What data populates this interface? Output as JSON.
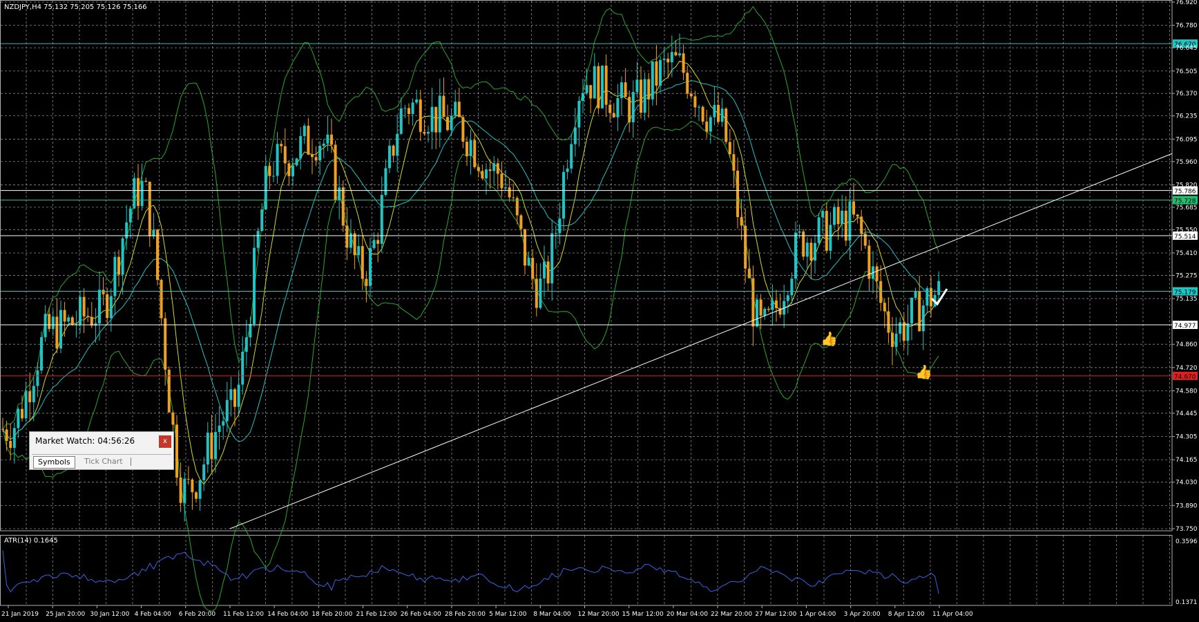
{
  "symbol_info": "NZDJPY,H4  75.132 75.205 75.126 75.166",
  "indicator_label": "ATR(14) 0.1645",
  "price_axis": {
    "ticks": [
      "76.920",
      "76.780",
      "76.645",
      "76.505",
      "76.370",
      "76.235",
      "76.095",
      "75.960",
      "75.820",
      "75.685",
      "75.550",
      "75.410",
      "75.275",
      "75.135",
      "74.860",
      "74.720",
      "74.580",
      "74.445",
      "74.305",
      "74.165",
      "74.030",
      "73.890",
      "73.750"
    ],
    "levels": [
      {
        "label": "76.670",
        "value": 76.67,
        "color": "#20c4c4"
      },
      {
        "label": "75.786",
        "value": 75.786,
        "color": "#ffffff"
      },
      {
        "label": "75.728",
        "value": 75.728,
        "color": "#20c070"
      },
      {
        "label": "75.514",
        "value": 75.514,
        "color": "#ffffff"
      },
      {
        "label": "75.179",
        "value": 75.179,
        "color": "#20c4c4"
      },
      {
        "label": "74.977",
        "value": 74.977,
        "color": "#ffffff"
      },
      {
        "label": "74.670",
        "value": 74.67,
        "color": "#e02020"
      }
    ]
  },
  "atr_axis": {
    "top_label": "0.3596",
    "bottom_label": "0.1371"
  },
  "time_axis": [
    "21 Jan 2019",
    "25 Jan 20:00",
    "30 Jan 12:00",
    "4 Feb 04:00",
    "6 Feb 20:00",
    "11 Feb 12:00",
    "14 Feb 04:00",
    "18 Feb 20:00",
    "21 Feb 12:00",
    "26 Feb 04:00",
    "28 Feb 20:00",
    "5 Mar 12:00",
    "8 Mar 04:00",
    "12 Mar 20:00",
    "15 Mar 12:00",
    "20 Mar 04:00",
    "22 Mar 20:00",
    "27 Mar 12:00",
    "1 Apr 04:00",
    "3 Apr 20:00",
    "8 Apr 12:00",
    "11 Apr 04:00"
  ],
  "market_watch": {
    "title": "Market Watch: 04:56:26",
    "close": "x",
    "tabs": [
      "Symbols",
      "Tick Chart"
    ]
  },
  "icons": [
    "thumb-up-icon",
    "thumb-up-icon",
    "check-mark-icon"
  ],
  "colors": {
    "bull": "#20c4c4",
    "bear": "#f0a020",
    "bands": "#2aa82a",
    "ma_fast": "#d8d820",
    "ma_slow": "#20c4c4",
    "atr": "#3a64e6",
    "grid": "#8a8a8a"
  },
  "chart_data": {
    "type": "candlestick",
    "symbol": "NZDJPY",
    "timeframe": "H4",
    "last_ohlc": {
      "open": 75.132,
      "high": 75.205,
      "low": 75.126,
      "close": 75.166
    },
    "ylim": [
      73.75,
      76.92
    ],
    "close_path": [
      {
        "t": "21 Jan 2019",
        "close": 74.35
      },
      {
        "t": "25 Jan 20:00",
        "close": 74.95
      },
      {
        "t": "30 Jan 12:00",
        "close": 75.05
      },
      {
        "t": "4 Feb 04:00",
        "close": 75.8
      },
      {
        "t": "6 Feb 20:00",
        "close": 73.98
      },
      {
        "t": "11 Feb 12:00",
        "close": 74.45
      },
      {
        "t": "14 Feb 04:00",
        "close": 75.95
      },
      {
        "t": "18 Feb 20:00",
        "close": 76.1
      },
      {
        "t": "21 Feb 12:00",
        "close": 75.3
      },
      {
        "t": "26 Feb 04:00",
        "close": 76.3
      },
      {
        "t": "28 Feb 20:00",
        "close": 76.2
      },
      {
        "t": "5 Mar 12:00",
        "close": 75.9
      },
      {
        "t": "8 Mar 04:00",
        "close": 75.2
      },
      {
        "t": "12 Mar 20:00",
        "close": 76.45
      },
      {
        "t": "15 Mar 12:00",
        "close": 76.3
      },
      {
        "t": "20 Mar 04:00",
        "close": 76.55
      },
      {
        "t": "22 Mar 20:00",
        "close": 76.2
      },
      {
        "t": "27 Mar 12:00",
        "close": 74.95
      },
      {
        "t": "1 Apr 04:00",
        "close": 75.5
      },
      {
        "t": "3 Apr 20:00",
        "close": 75.6
      },
      {
        "t": "8 Apr 12:00",
        "close": 74.95
      },
      {
        "t": "11 Apr 04:00",
        "close": 75.166
      }
    ],
    "horizontal_levels": [
      76.67,
      75.786,
      75.728,
      75.514,
      75.179,
      74.977,
      74.67
    ],
    "trendline": [
      {
        "t": "11 Feb 12:00",
        "price": 73.75
      },
      {
        "t": "11 Apr 04:00",
        "price": 75.45
      }
    ],
    "atr": {
      "name": "ATR(14)",
      "value": 0.1645,
      "ylim": [
        0.1371,
        0.3596
      ]
    }
  }
}
